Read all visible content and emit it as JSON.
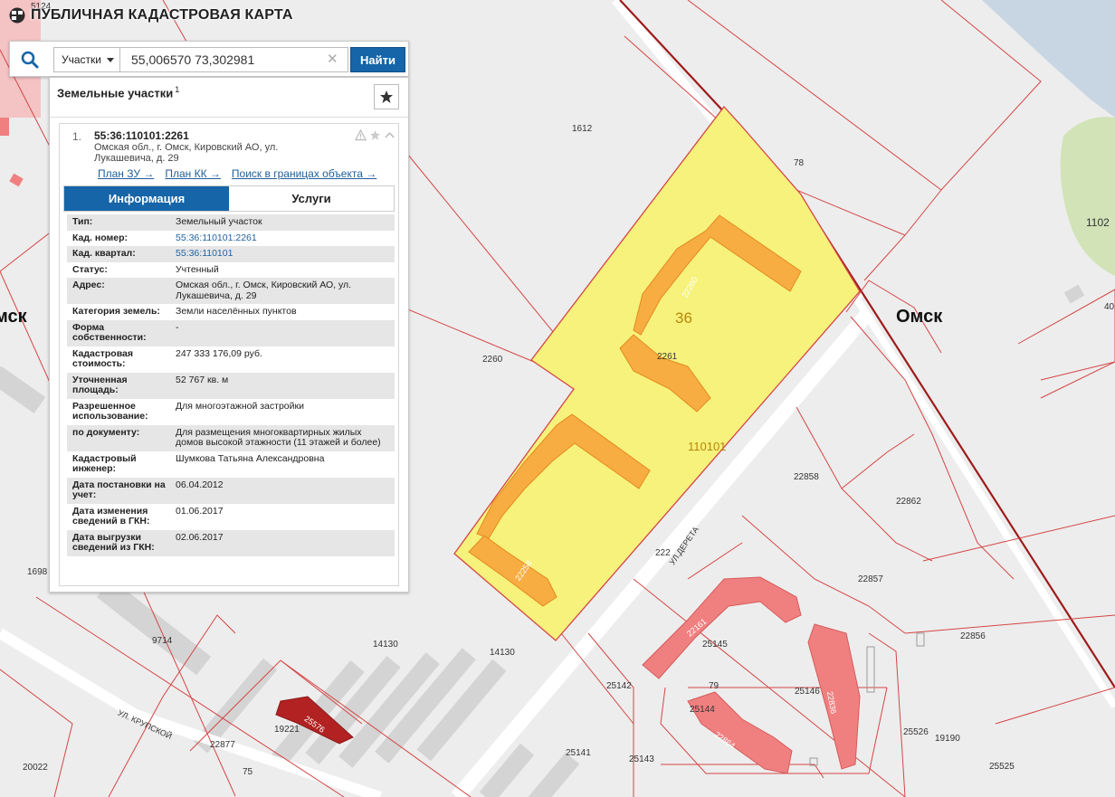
{
  "app": {
    "title": "ПУБЛИЧНАЯ КАДАСТРОВАЯ КАРТА"
  },
  "search": {
    "type_label": "Участки",
    "query": "55,006570 73,302981",
    "button_label": "Найти"
  },
  "results": {
    "title": "Земельные участки",
    "count": "1"
  },
  "card": {
    "index": "1.",
    "cadastral_number": "55:36:110101:2261",
    "address": "Омская обл., г. Омск, Кировский АО, ул. Лукашевича, д. 29",
    "links": [
      "План ЗУ →",
      "План КК →",
      "Поиск в границах объекта →"
    ],
    "tabs": {
      "info": "Информация",
      "services": "Услуги"
    },
    "info_rows": [
      {
        "key": "Тип:",
        "value": "Земельный участок"
      },
      {
        "key": "Кад. номер:",
        "value": "55:36:110101:2261",
        "link": true
      },
      {
        "key": "Кад. квартал:",
        "value": "55:36:110101",
        "link": true
      },
      {
        "key": "Статус:",
        "value": "Учтенный"
      },
      {
        "key": "Адрес:",
        "value": "Омская обл., г. Омск, Кировский АО, ул. Лукашевича, д. 29"
      },
      {
        "key": "Категория земель:",
        "value": "Земли населённых пунктов"
      },
      {
        "key": "Форма собственности:",
        "value": "-"
      },
      {
        "key": "Кадастровая стоимость:",
        "value": "247 333 176,09 руб."
      },
      {
        "key": "Уточненная площадь:",
        "value": "52 767 кв. м"
      },
      {
        "key": "Разрешенное использование:",
        "value": "Для многоэтажной застройки"
      },
      {
        "key": "по документу:",
        "value": "Для размещения многоквартирных жилых домов высокой этажности (11 этажей и более)"
      },
      {
        "key": "Кадастровый инженер:",
        "value": "Шумкова Татьяна Александровна"
      },
      {
        "key": "Дата постановки на учет:",
        "value": "06.04.2012"
      },
      {
        "key": "Дата изменения сведений в ГКН:",
        "value": "01.06.2017"
      },
      {
        "key": "Дата выгрузки сведений из ГКН:",
        "value": "02.06.2017"
      }
    ]
  },
  "map": {
    "city_labels": [
      "Омск",
      "мск"
    ],
    "quarter_labels": [
      "36",
      "110101"
    ],
    "parcel_labels": [
      "5124",
      "1612",
      "78",
      "1102",
      "2260",
      "22858",
      "22862",
      "22857",
      "22856",
      "9714",
      "14130",
      "14130",
      "25145",
      "25142",
      "25146",
      "79",
      "25144",
      "25141",
      "25143",
      "25526",
      "19190",
      "25525",
      "1698",
      "20022",
      "19221",
      "22877",
      "75",
      "222",
      "2261",
      "22260",
      "22258",
      "22161",
      "22864",
      "22836",
      "25576",
      "40"
    ],
    "street_labels": [
      "УЛ.ДЕРЕТА",
      "УЛ. КРУПСКОЙ"
    ],
    "colors": {
      "background": "#ededed",
      "parcel_border": "#d64545",
      "selected_parcel": "#f6f27c",
      "buildings": "#f7ad42",
      "pink_buildings": "#f08080",
      "red_building": "#b22222",
      "water": "#c7d6e2",
      "green": "#cfe2b4",
      "button": "#1565a8"
    },
    "icons": [
      "search-icon",
      "star-icon",
      "warning-icon",
      "chevron-up-icon",
      "clear-icon",
      "logo-icon"
    ]
  }
}
